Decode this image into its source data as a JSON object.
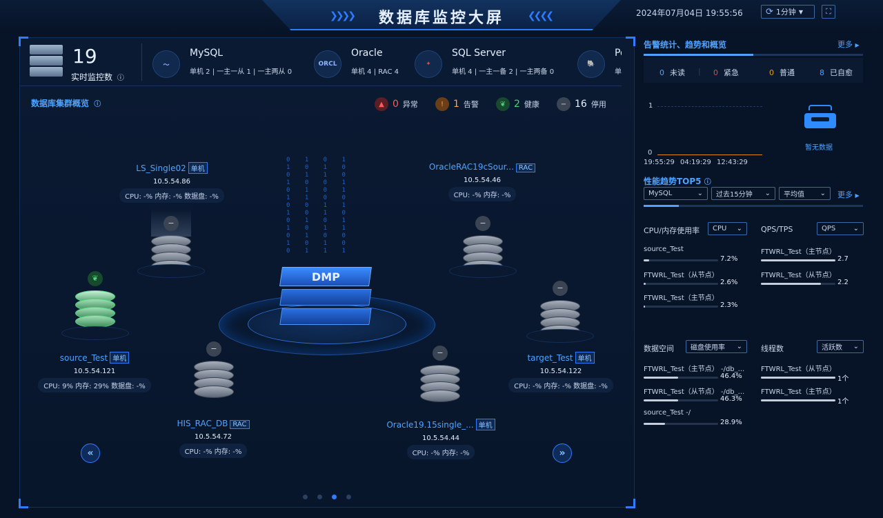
{
  "header": {
    "title": "数据库监控大屏",
    "datetime": "2024年07月04日 19:55:56",
    "refresh_label": "1分钟",
    "refresh_icon": "refresh-icon",
    "fullscreen_icon": "fullscreen-icon"
  },
  "stats": {
    "monitor_count": "19",
    "monitor_label": "实时监控数",
    "db_types": [
      {
        "name": "MySQL",
        "icon": "mysql-dolphin-icon",
        "details": "单机 2  |  一主一从 1  |  一主两从 0"
      },
      {
        "name": "Oracle",
        "icon": "oracle-icon",
        "logo_text": "ORCL",
        "details": "单机 4  |  RAC 4"
      },
      {
        "name": "SQL Server",
        "icon": "sqlserver-icon",
        "details": "单机 4  |  一主一备 2  |  一主两备 0"
      },
      {
        "name": "Po",
        "icon": "postgresql-icon",
        "details": "单机"
      }
    ]
  },
  "cluster": {
    "title": "数据库集群概览",
    "status": [
      {
        "count": "0",
        "label": "异常",
        "color": "#d23b3b"
      },
      {
        "count": "1",
        "label": "告警",
        "color": "#e07a1f"
      },
      {
        "count": "2",
        "label": "健康",
        "color": "#2fa65a"
      },
      {
        "count": "16",
        "label": "停用",
        "color": "#8a94a3"
      }
    ],
    "center_label": "DMP",
    "nodes": [
      {
        "name": "LS_Single02",
        "tag": "单机",
        "ip": "10.5.54.86",
        "metrics": "CPU: -% 内存: -% 数据盘: -%"
      },
      {
        "name": "OracleRAC19cSour...",
        "tag": "RAC",
        "ip": "10.5.54.46",
        "metrics": "CPU: -% 内存: -%"
      },
      {
        "name": "source_Test",
        "tag": "单机",
        "ip": "10.5.54.121",
        "metrics": "CPU: 9% 内存: 29% 数据盘: -%"
      },
      {
        "name": "target_Test",
        "tag": "单机",
        "ip": "10.5.54.122",
        "metrics": "CPU: -% 内存: -% 数据盘: -%"
      },
      {
        "name": "HIS_RAC_DB",
        "tag": "RAC",
        "ip": "10.5.54.72",
        "metrics": "CPU: -% 内存: -%"
      },
      {
        "name": "Oracle19.15single_...",
        "tag": "单机",
        "ip": "10.5.54.44",
        "metrics": "CPU: -% 内存: -%"
      }
    ],
    "active_page": 3,
    "page_count": 4
  },
  "alerts": {
    "title": "告警统计、趋势和概览",
    "more": "更多",
    "counts": [
      {
        "count": "0",
        "label": "未读",
        "color": "#4fa3ff"
      },
      {
        "count": "0",
        "label": "紧急",
        "color": "#e0484d"
      },
      {
        "count": "0",
        "label": "普通",
        "color": "#e0a01f"
      },
      {
        "count": "8",
        "label": "已自愈",
        "color": "#4fa3ff"
      }
    ],
    "trend": {
      "y_ticks": [
        "1",
        "0"
      ],
      "x_ticks": [
        "19:55:29",
        "04:19:29",
        "12:43:29"
      ]
    },
    "empty_text": "暂无数据"
  },
  "perf": {
    "title": "性能趋势TOP5",
    "more": "更多",
    "filters": {
      "db": "MySQL",
      "range": "过去15分钟",
      "agg": "平均值"
    },
    "cpu": {
      "label": "CPU/内存使用率",
      "select": "CPU",
      "items": [
        {
          "name": "source_Test",
          "value": "7.2%",
          "pct": 7.2
        },
        {
          "name": "FTWRL_Test（从节点）",
          "value": "2.6%",
          "pct": 2.6
        },
        {
          "name": "FTWRL_Test（主节点）",
          "value": "2.3%",
          "pct": 2.3
        }
      ]
    },
    "qps": {
      "label": "QPS/TPS",
      "select": "QPS",
      "items": [
        {
          "name": "FTWRL_Test（主节点）",
          "value": "2.7",
          "pct": 100
        },
        {
          "name": "FTWRL_Test（从节点）",
          "value": "2.2",
          "pct": 81
        }
      ]
    },
    "space": {
      "label": "数据空间",
      "select": "磁盘使用率",
      "items": [
        {
          "name": "FTWRL_Test（主节点） -/db_...",
          "value": "46.4%",
          "pct": 46.4
        },
        {
          "name": "FTWRL_Test（从节点） -/db_...",
          "value": "46.3%",
          "pct": 46.3
        },
        {
          "name": "source_Test -/",
          "value": "28.9%",
          "pct": 28.9
        }
      ]
    },
    "threads": {
      "label": "线程数",
      "select": "活跃数",
      "items": [
        {
          "name": "FTWRL_Test（从节点）",
          "value": "1个",
          "pct": 100
        },
        {
          "name": "FTWRL_Test（主节点）",
          "value": "1个",
          "pct": 100
        }
      ]
    }
  }
}
